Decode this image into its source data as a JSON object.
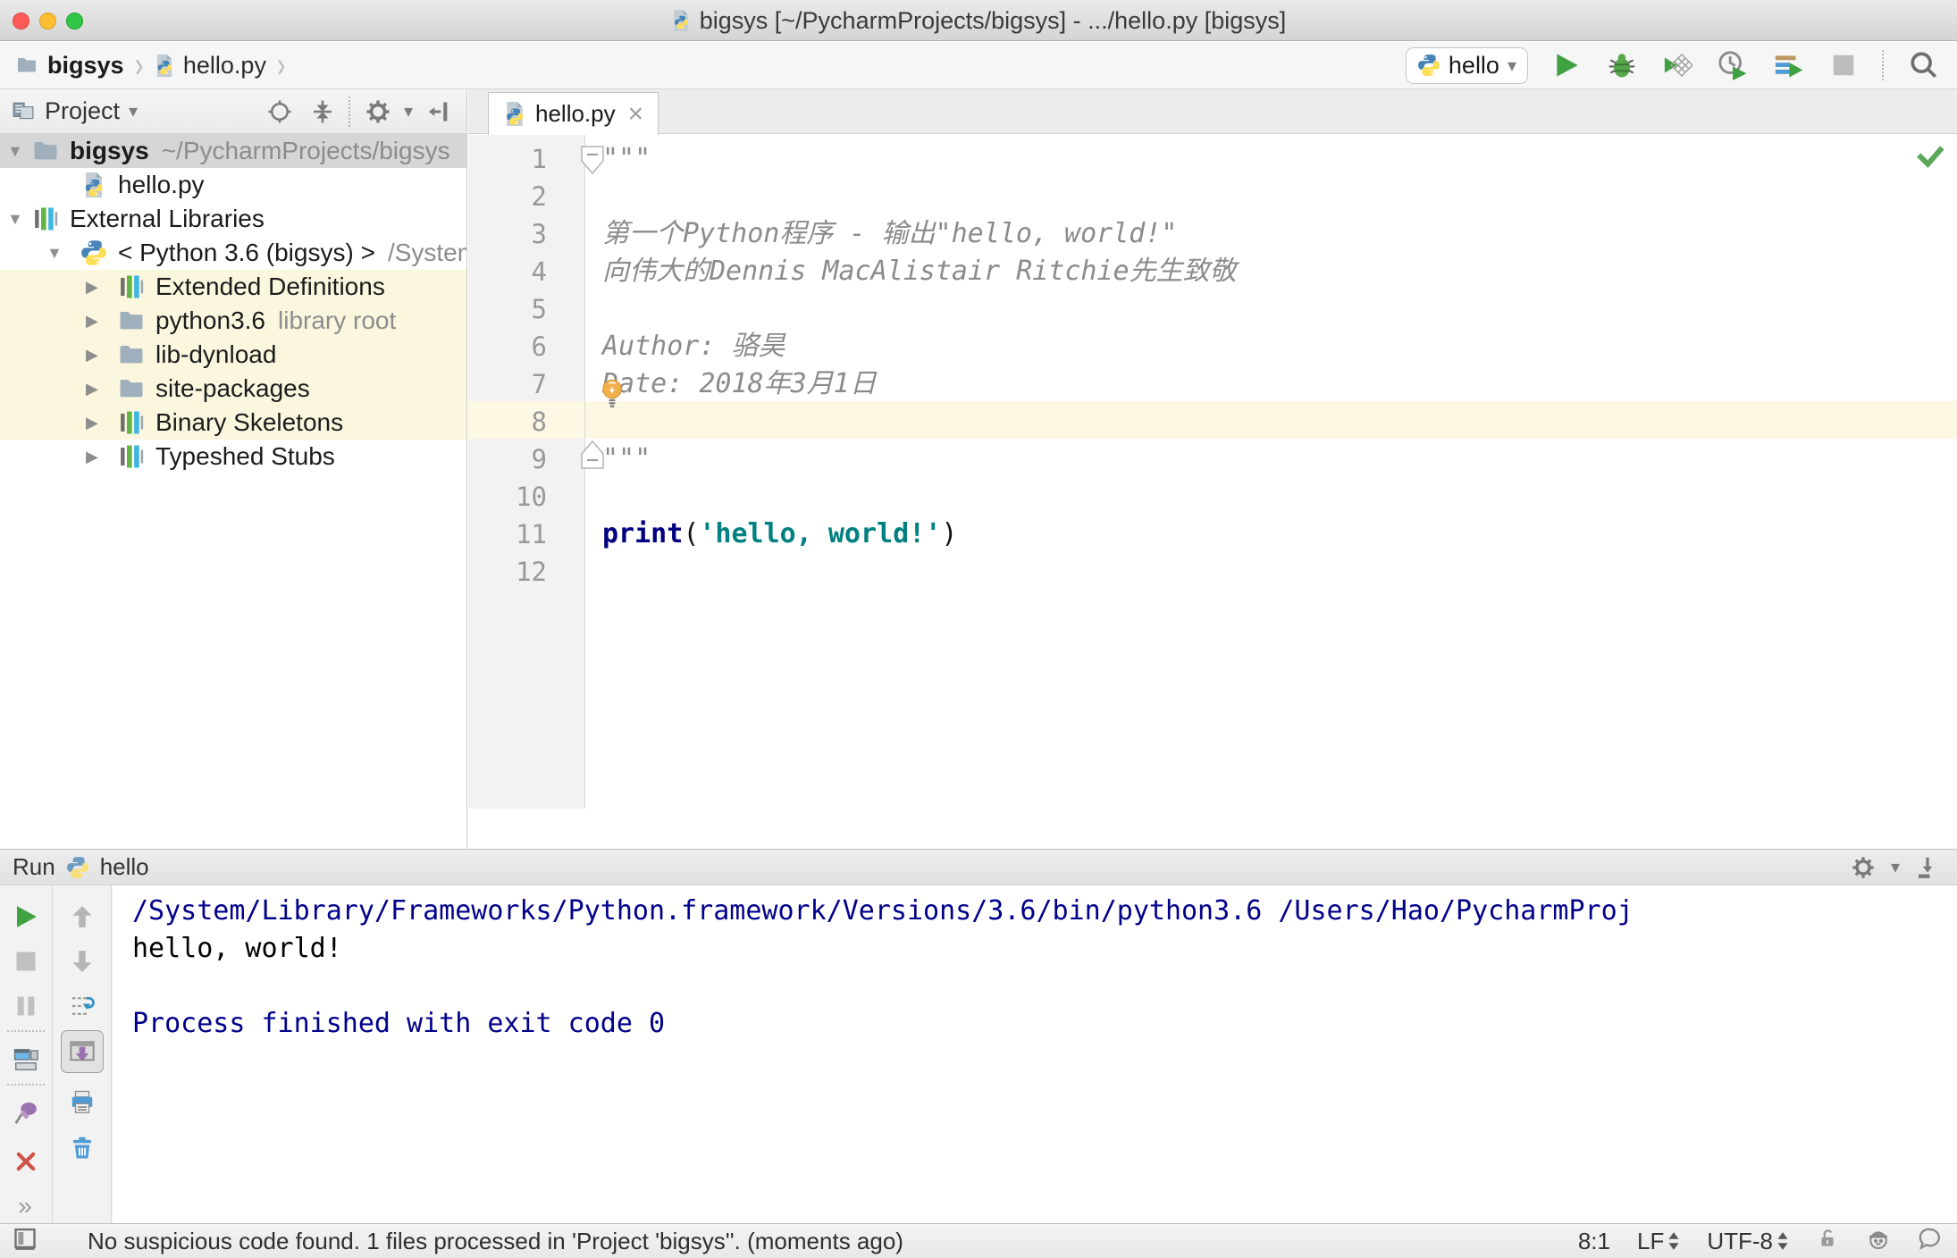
{
  "window": {
    "title": "bigsys [~/PycharmProjects/bigsys] - .../hello.py [bigsys]"
  },
  "glyphs": {
    "chevron": "›",
    "dropdown": "▾",
    "tree_open": "▼",
    "tree_closed": "▶",
    "close": "×",
    "more": "»"
  },
  "navbar": {
    "crumb_project": "bigsys",
    "crumb_file": "hello.py",
    "run_config": "hello"
  },
  "project": {
    "title": "Project",
    "tree": {
      "root_label": "bigsys",
      "root_path": "~/PycharmProjects/bigsys",
      "file": "hello.py",
      "ext_lib": "External Libraries",
      "python": "< Python 3.6 (bigsys) >",
      "python_path": "/System",
      "extended": "Extended Definitions",
      "python36": "python3.6",
      "python36_tag": "library root",
      "libdynload": "lib-dynload",
      "sitepackages": "site-packages",
      "binary": "Binary Skeletons",
      "typeshed": "Typeshed Stubs"
    }
  },
  "editor": {
    "tab": "hello.py",
    "nums": [
      "1",
      "2",
      "3",
      "4",
      "5",
      "6",
      "7",
      "8",
      "9",
      "10",
      "11",
      "12"
    ],
    "l1": "\"\"\"",
    "l3": "第一个Python程序 - 输出\"hello, world!\"",
    "l4": "向伟大的Dennis MacAlistair Ritchie先生致敬",
    "l6": "Author: 骆昊",
    "l7": "Date: 2018年3月1日",
    "l9": "\"\"\"",
    "l11_kw": "print",
    "l11_open": "(",
    "l11_str": "'hello, world!'",
    "l11_close": ")"
  },
  "run": {
    "label": "Run",
    "config": "hello",
    "console_line1": "/System/Library/Frameworks/Python.framework/Versions/3.6/bin/python3.6 /Users/Hao/PycharmProj",
    "console_line2": "hello, world!",
    "console_line4": "Process finished with exit code 0"
  },
  "statusbar": {
    "message": "No suspicious code found. 1 files processed in 'Project 'bigsys''. (moments ago)",
    "position": "8:1",
    "line_separator": "LF",
    "encoding": "UTF-8"
  },
  "colors": {
    "python_blue": "#4584b6",
    "python_yellow": "#ffde57",
    "run_green": "#3fa142",
    "keyword_navy": "#000080",
    "string_teal": "#008080",
    "console_navy": "#00008b",
    "caret_line_bg": "#fcf8e3",
    "tree_highlight_bg": "#fbf7df",
    "selected_row_bg": "#d6d6d6"
  }
}
